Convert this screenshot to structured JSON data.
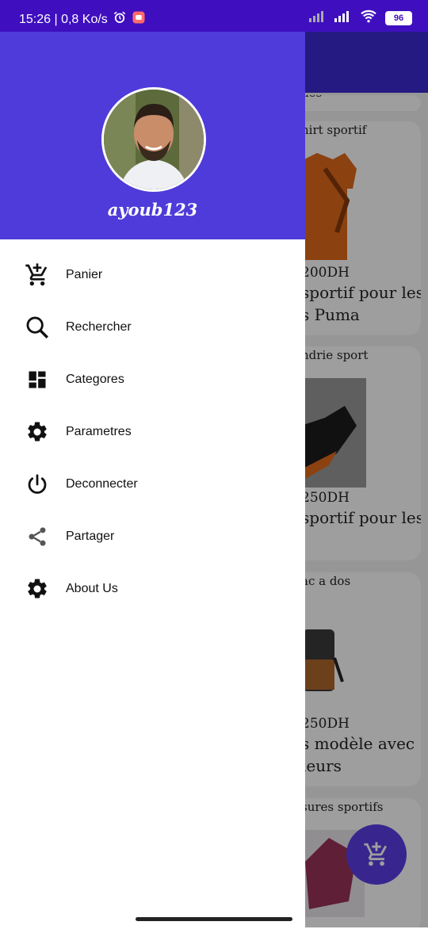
{
  "status_bar": {
    "left_text": "15:26 | 0,8 Ko/s",
    "battery": "96",
    "icons": [
      "alarm-icon",
      "app-notification-icon",
      "signal-icon",
      "signal-icon",
      "wifi-icon",
      "battery-icon"
    ]
  },
  "drawer": {
    "username": "ayoub123",
    "header_color": "#4f3bd9",
    "menu": [
      {
        "label": "Panier",
        "icon": "add-to-cart-icon"
      },
      {
        "label": "Rechercher",
        "icon": "search-icon"
      },
      {
        "label": "Categores",
        "icon": "dashboard-icon"
      },
      {
        "label": "Parametres",
        "icon": "gear-icon"
      },
      {
        "label": "Deconnecter",
        "icon": "power-icon"
      },
      {
        "label": "Partager",
        "icon": "share-icon"
      },
      {
        "label": "About Us",
        "icon": "gear-icon"
      }
    ]
  },
  "background_products": [
    {
      "title_fragment": "nes"
    },
    {
      "title_fragment": "hirt sportif",
      "price_fragment": "200DH",
      "desc_fragment": [
        "sportif pour les",
        "s Puma"
      ]
    },
    {
      "title_fragment": "ndrie sport",
      "price_fragment": "250DH",
      "desc_fragment": [
        "sportif pour les"
      ]
    },
    {
      "title_fragment": "ac a dos",
      "price_fragment": "250DH",
      "desc_fragment": [
        "s modèle avec",
        "leurs"
      ]
    },
    {
      "title_fragment": "sures sportifs"
    }
  ],
  "fab": {
    "icon": "add-to-cart-icon"
  },
  "colors": {
    "status_bar": "#3f0fbf",
    "app_bar": "#3b2ad0",
    "fab": "#5b3ee6"
  }
}
